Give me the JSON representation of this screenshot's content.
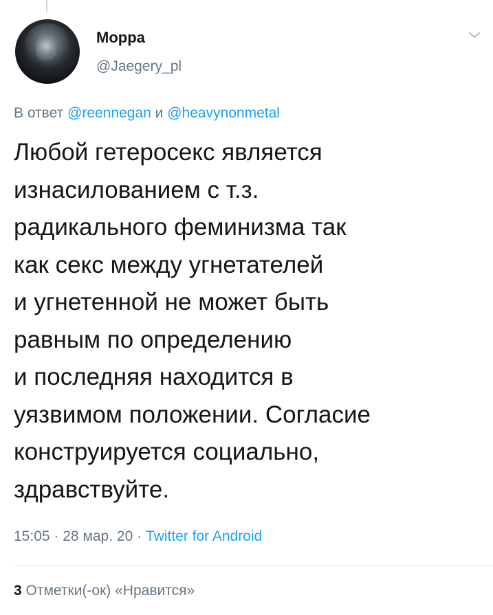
{
  "author": {
    "display_name": "Морра",
    "handle": "@Jaegery_pl",
    "avatar_icon": "profile-photo"
  },
  "reply_to": {
    "prefix": "В ответ",
    "mention_1": "@reennegan",
    "conjunction": "и",
    "mention_2": "@heavynonmetal"
  },
  "tweet": {
    "lines": [
      "Любой гетеросекс является",
      "изнасилованием с т.з.",
      "радикального феминизма так",
      "как секс между угнетателей",
      "и угнетенной не может быть",
      "равным по определению",
      "и последняя находится в",
      "уязвимом положении. Согласие",
      "конструируется социально,",
      "здравствуйте."
    ]
  },
  "meta": {
    "time": "15:05",
    "separator": "·",
    "date": "28 мар. 20",
    "source": "Twitter for Android"
  },
  "stats": {
    "likes_count": "3",
    "likes_label": "Отметки(-ок) «Нравится»"
  },
  "colors": {
    "link": "#1da1f2",
    "secondary_text": "#657786",
    "primary_text": "#14171a",
    "divider": "#e1e8ed"
  },
  "icons": {
    "menu": "chevron-down-icon"
  }
}
